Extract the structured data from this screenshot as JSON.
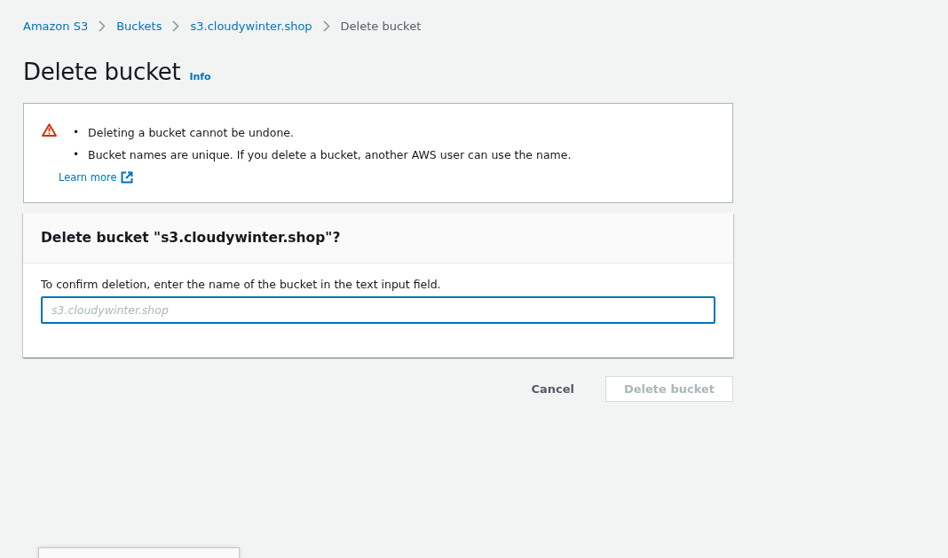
{
  "breadcrumbs": [
    {
      "label": "Amazon S3",
      "current": false
    },
    {
      "label": "Buckets",
      "current": false
    },
    {
      "label": "s3.cloudywinter.shop",
      "current": false
    },
    {
      "label": "Delete bucket",
      "current": true
    }
  ],
  "page_title": "Delete bucket",
  "info_link": "Info",
  "alert": {
    "items": [
      {
        "bullet": "•",
        "text": "Deleting a bucket cannot be undone."
      },
      {
        "bullet": "•",
        "text": "Bucket names are unique. If you delete a bucket, another AWS user can use the name."
      }
    ],
    "link": "Learn more"
  },
  "confirm_panel": {
    "title": "Delete bucket \"s3.cloudywinter.shop\"?",
    "description": "To confirm deletion, enter the name of the bucket in the text input field.",
    "input": {
      "placeholder": "s3.cloudywinter.shop"
    }
  },
  "buttons": [
    {
      "label": "Cancel",
      "kind": "link",
      "disabled": false
    },
    {
      "label": "Delete bucket",
      "kind": "primary",
      "disabled": true
    }
  ]
}
